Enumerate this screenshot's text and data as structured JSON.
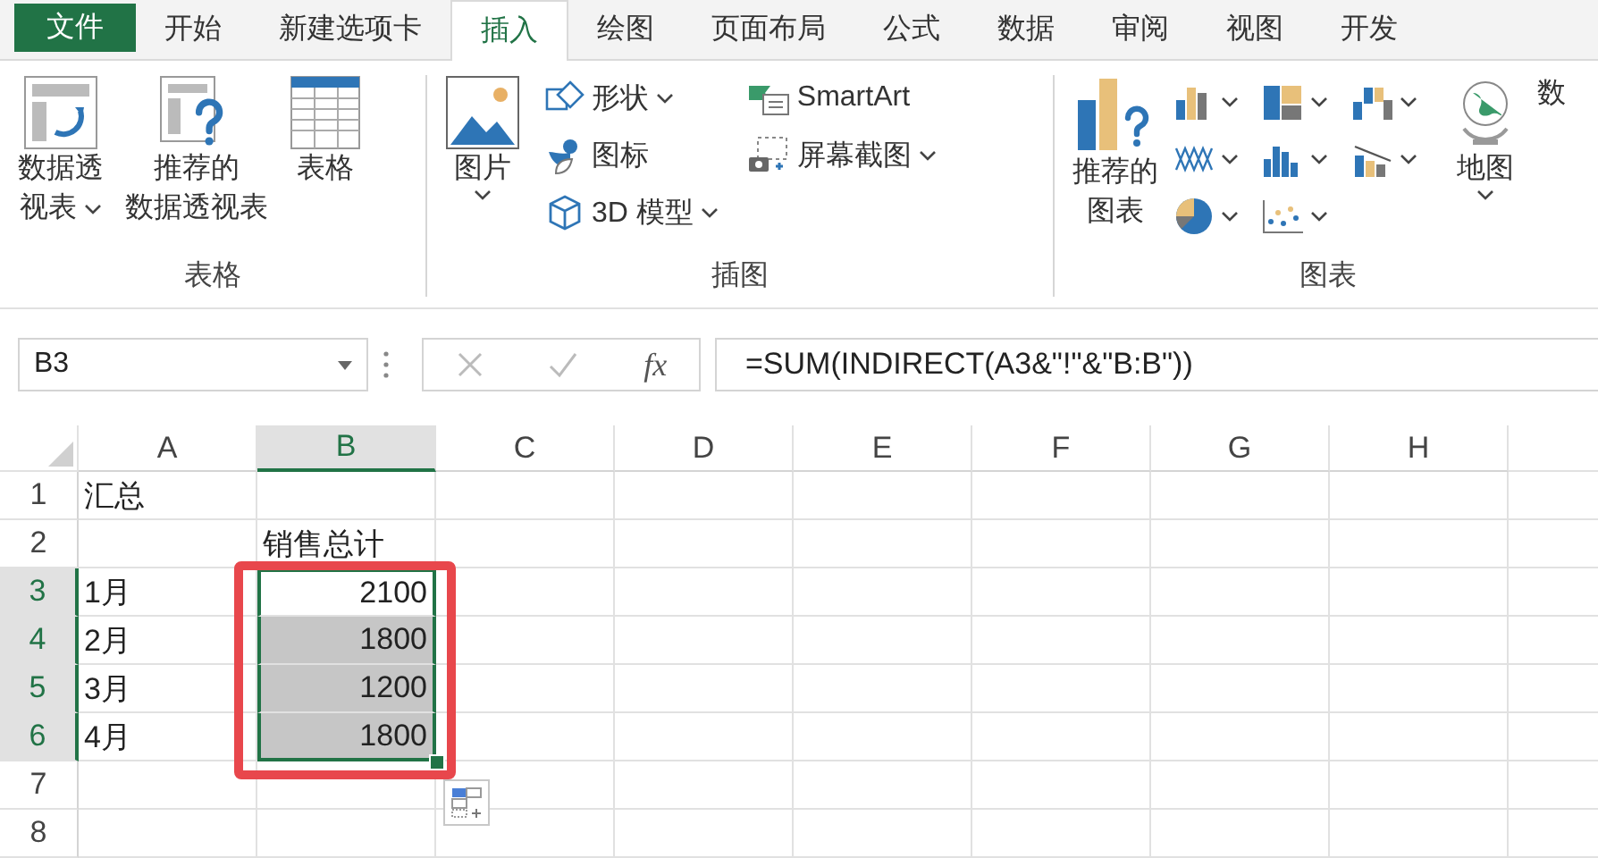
{
  "tabs": [
    {
      "label": "文件",
      "kind": "file",
      "selected": false
    },
    {
      "label": "开始",
      "kind": "tab",
      "selected": false
    },
    {
      "label": "新建选项卡",
      "kind": "tab",
      "selected": false
    },
    {
      "label": "插入",
      "kind": "tab",
      "selected": true
    },
    {
      "label": "绘图",
      "kind": "tab",
      "selected": false
    },
    {
      "label": "页面布局",
      "kind": "tab",
      "selected": false
    },
    {
      "label": "公式",
      "kind": "tab",
      "selected": false
    },
    {
      "label": "数据",
      "kind": "tab",
      "selected": false
    },
    {
      "label": "审阅",
      "kind": "tab",
      "selected": false
    },
    {
      "label": "视图",
      "kind": "tab",
      "selected": false
    },
    {
      "label": "开发",
      "kind": "tab",
      "selected": false
    }
  ],
  "ribbon_groups": [
    {
      "label": "表格",
      "columns": [
        {
          "kind": "large",
          "lines": [
            "数据透",
            "视表"
          ],
          "dropdown": true
        },
        {
          "kind": "large",
          "lines": [
            "推荐的",
            "数据透视表"
          ],
          "dropdown": false
        },
        {
          "kind": "large",
          "lines": [
            "表格"
          ],
          "dropdown": false
        }
      ]
    },
    {
      "label": "插图",
      "columns": [
        {
          "kind": "large",
          "lines": [
            "图片"
          ],
          "dropdown": true
        },
        {
          "kind": "small",
          "items": [
            {
              "label": "形状",
              "dropdown": true
            },
            {
              "label": "图标",
              "dropdown": false
            },
            {
              "label": "3D 模型",
              "dropdown": true
            }
          ]
        },
        {
          "kind": "small",
          "items": [
            {
              "label": "SmartArt",
              "dropdown": false
            },
            {
              "label": "屏幕截图",
              "dropdown": true
            }
          ]
        }
      ]
    },
    {
      "label": "图表",
      "columns": [
        {
          "kind": "large",
          "lines": [
            "推荐的",
            "图表"
          ],
          "dropdown": false
        },
        {
          "kind": "charts"
        },
        {
          "kind": "large",
          "lines": [
            "地图"
          ],
          "dropdown": true
        },
        {
          "kind": "large",
          "lines": [
            "数"
          ],
          "dropdown": false
        }
      ]
    }
  ],
  "formula_bar": {
    "name_box": "B3",
    "function_label": "fx",
    "formula": "=SUM(INDIRECT(A3&\"!\"&\"B:B\"))"
  },
  "columns": [
    {
      "label": "A",
      "selected": false
    },
    {
      "label": "B",
      "selected": true
    },
    {
      "label": "C",
      "selected": false
    },
    {
      "label": "D",
      "selected": false
    },
    {
      "label": "E",
      "selected": false
    },
    {
      "label": "F",
      "selected": false
    },
    {
      "label": "G",
      "selected": false
    },
    {
      "label": "H",
      "selected": false
    }
  ],
  "rows": [
    {
      "label": "1",
      "selected": false,
      "cells": [
        {
          "text": "汇总",
          "kind": "text",
          "selected": false
        }
      ]
    },
    {
      "label": "2",
      "selected": false,
      "cells": [
        null,
        {
          "text": "销售总计",
          "kind": "text",
          "selected": false
        }
      ]
    },
    {
      "label": "3",
      "selected": true,
      "cells": [
        {
          "text": "1月",
          "kind": "text",
          "selected": false
        },
        {
          "text": "2100",
          "kind": "number",
          "selected": true
        }
      ]
    },
    {
      "label": "4",
      "selected": true,
      "cells": [
        {
          "text": "2月",
          "kind": "text",
          "selected": false
        },
        {
          "text": "1800",
          "kind": "number",
          "selected": true
        }
      ]
    },
    {
      "label": "5",
      "selected": true,
      "cells": [
        {
          "text": "3月",
          "kind": "text",
          "selected": false
        },
        {
          "text": "1200",
          "kind": "number",
          "selected": true
        }
      ]
    },
    {
      "label": "6",
      "selected": true,
      "cells": [
        {
          "text": "4月",
          "kind": "text",
          "selected": false
        },
        {
          "text": "1800",
          "kind": "number",
          "selected": true
        }
      ]
    },
    {
      "label": "7",
      "selected": false
    },
    {
      "label": "8",
      "selected": false
    }
  ]
}
